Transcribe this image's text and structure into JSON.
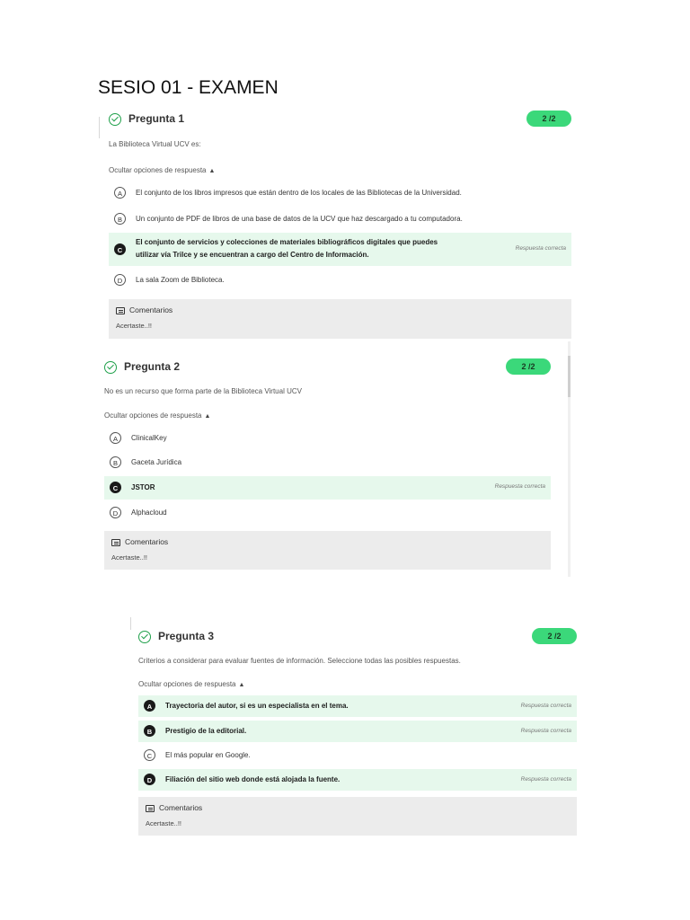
{
  "page_title": "SESIO 01 - EXAMEN",
  "questions": [
    {
      "title": "Pregunta 1",
      "score": "2 /2",
      "prompt": "La Biblioteca Virtual UCV es:",
      "toggle_label": "Ocultar opciones de respuesta",
      "options": [
        {
          "letter": "A",
          "text": "El conjunto de los libros impresos que están dentro de los locales de las Bibliotecas de la Universidad.",
          "correct": false
        },
        {
          "letter": "B",
          "text": "Un conjunto de PDF de libros de una base de datos de la UCV que haz descargado a tu computadora.",
          "correct": false
        },
        {
          "letter": "C",
          "text_line1": "El conjunto de servicios y colecciones de materiales bibliográficos digitales que puedes",
          "text_line2": "utilizar vía Trilce y se encuentran a cargo del Centro de Información.",
          "correct": true,
          "tag": "Respuesta correcta"
        },
        {
          "letter": "D",
          "text": "La sala Zoom de Biblioteca.",
          "correct": false
        }
      ],
      "comments_title": "Comentarios",
      "comment": "Acertaste..!!"
    },
    {
      "title": "Pregunta 2",
      "score": "2 /2",
      "prompt": "No es un recurso que forma parte de la Biblioteca Virtual UCV",
      "toggle_label": "Ocultar opciones de respuesta",
      "options": [
        {
          "letter": "A",
          "text": "ClinicalKey",
          "correct": false
        },
        {
          "letter": "B",
          "text": "Gaceta Jurídica",
          "correct": false
        },
        {
          "letter": "C",
          "text": "JSTOR",
          "correct": true,
          "tag": "Respuesta correcta"
        },
        {
          "letter": "D",
          "text": "Alphacloud",
          "correct": false
        }
      ],
      "comments_title": "Comentarios",
      "comment": "Acertaste..!!"
    },
    {
      "title": "Pregunta 3",
      "score": "2 /2",
      "prompt": "Criterios a considerar para evaluar fuentes de información. Seleccione todas las posibles respuestas.",
      "toggle_label": "Ocultar opciones de respuesta",
      "options": [
        {
          "letter": "A",
          "text": "Trayectoria del autor, si es un especialista en el tema.",
          "correct": true,
          "tag": "Respuesta correcta"
        },
        {
          "letter": "B",
          "text": "Prestigio de la editorial.",
          "correct": true,
          "tag": "Respuesta correcta"
        },
        {
          "letter": "C",
          "text": "El más popular en Google.",
          "correct": false
        },
        {
          "letter": "D",
          "text": "Filiación del sitio web donde está alojada la fuente.",
          "correct": true,
          "tag": "Respuesta correcta"
        }
      ],
      "comments_title": "Comentarios",
      "comment": "Acertaste..!!"
    }
  ],
  "colors": {
    "correct_bg": "#e6f8ec",
    "score_badge": "#3bd87a",
    "check": "#1fa04a"
  }
}
